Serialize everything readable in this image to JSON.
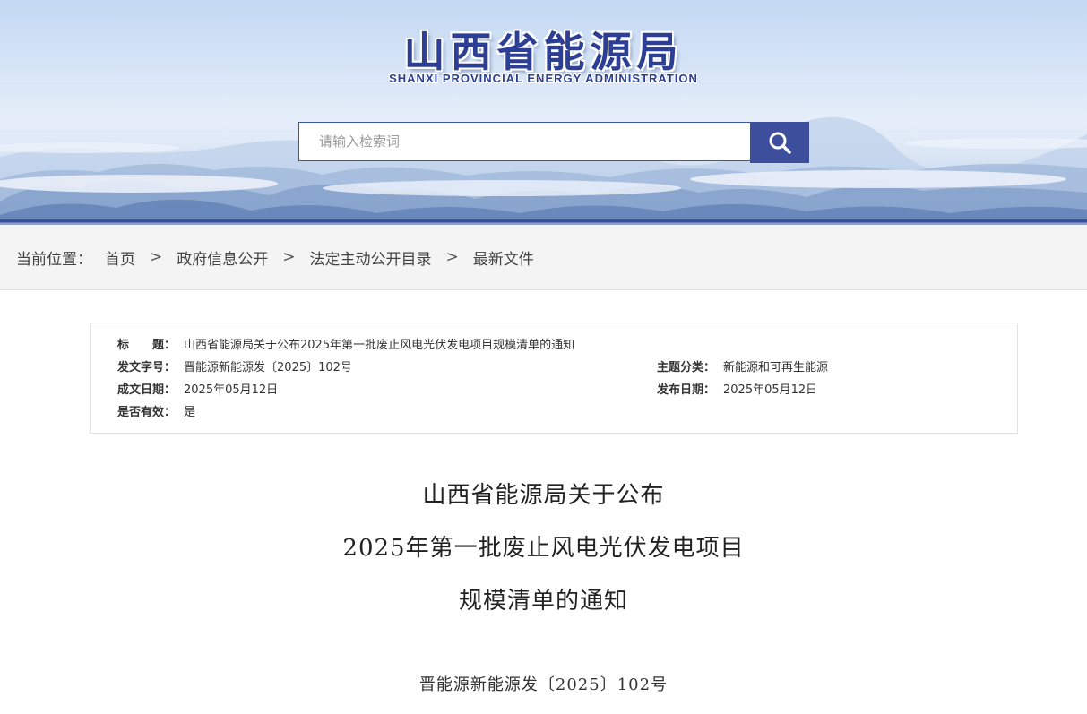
{
  "header": {
    "logo_cn": "山西省能源局",
    "logo_en": "SHANXI  PROVINCIAL  ENERGY  ADMINISTRATION",
    "search_placeholder": "请输入检索词",
    "search_icon": "search-icon",
    "colors": {
      "brand": "#3d4f9c",
      "sky": "#c3d8f3"
    }
  },
  "breadcrumb": {
    "prefix": "当前位置：",
    "items": [
      "首页",
      "政府信息公开",
      "法定主动公开目录",
      "最新文件"
    ],
    "separator": ">"
  },
  "meta": {
    "title_label": "标　　题：",
    "title_value": "山西省能源局关于公布2025年第一批废止风电光伏发电项目规模清单的通知",
    "doc_no_label": "发文字号：",
    "doc_no_value": "晋能源新能源发〔2025〕102号",
    "topic_label": "主题分类：",
    "topic_value": "新能源和可再生能源",
    "written_label": "成文日期：",
    "written_value": "2025年05月12日",
    "published_label": "发布日期：",
    "published_value": "2025年05月12日",
    "valid_label": "是否有效：",
    "valid_value": "是"
  },
  "document": {
    "title_lines": [
      "山西省能源局关于公布",
      "2025年第一批废止风电光伏发电项目",
      "规模清单的通知"
    ],
    "number": "晋能源新能源发〔2025〕102号"
  }
}
